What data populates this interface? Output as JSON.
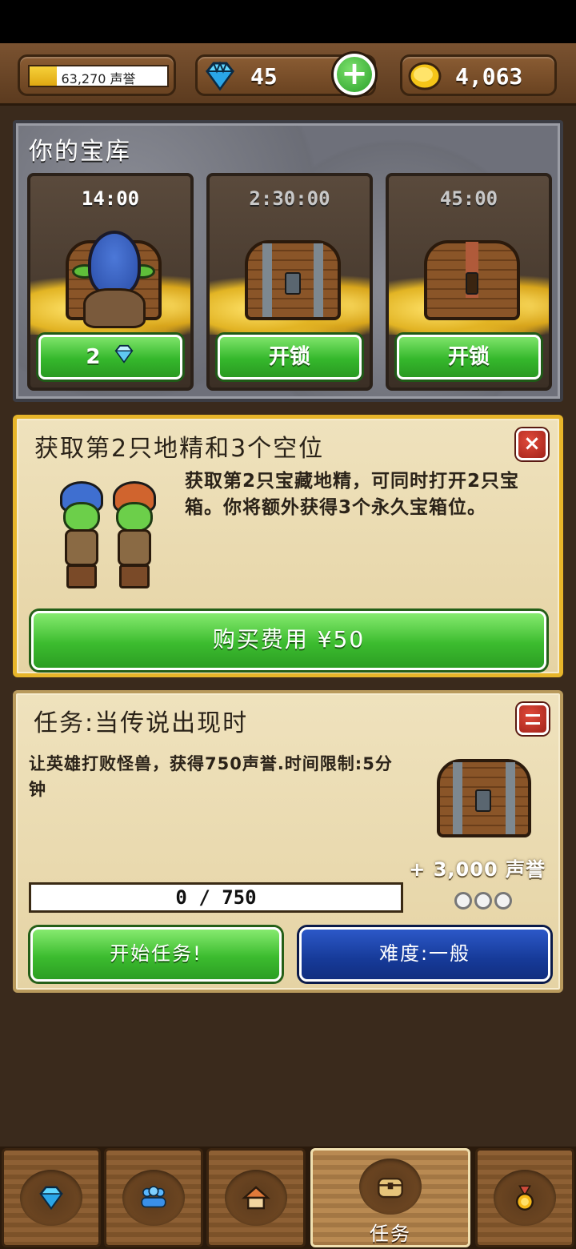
{
  "header": {
    "reputation_text": "63,270 声誉",
    "reputation_progress_percent": 20,
    "gems": "45",
    "gold": "4,063",
    "add_button_symbol": "+"
  },
  "vault": {
    "title": "你的宝库",
    "slots": [
      {
        "timer": "14:00",
        "contents": "goblin-on-chest",
        "button_label": "2",
        "button_icon": "gem-icon"
      },
      {
        "timer": "2:30:00",
        "contents": "iron-chest",
        "button_label": "开锁"
      },
      {
        "timer": "45:00",
        "contents": "wooden-chest",
        "button_label": "开锁"
      }
    ]
  },
  "offer": {
    "title": "获取第2只地精和3个空位",
    "close_symbol": "×",
    "description": "获取第2只宝藏地精，可同时打开2只宝箱。你将额外获得3个永久宝箱位。",
    "buy_label": "购买费用 ¥50"
  },
  "quest": {
    "title": "任务:当传说出现时",
    "description": "让英雄打败怪兽，获得750声誉.时间限制:5分钟",
    "reward": "+ 3,000 声誉",
    "difficulty_stars": 0,
    "progress_text": "0 / 750",
    "progress_percent": 0,
    "start_label": "开始任务!",
    "difficulty_label": "难度:一般"
  },
  "nav": {
    "tabs": [
      {
        "icon": "gem-icon",
        "label": ""
      },
      {
        "icon": "people-icon",
        "label": ""
      },
      {
        "icon": "home-icon",
        "label": ""
      },
      {
        "icon": "chest-icon",
        "label": "任务",
        "active": true
      },
      {
        "icon": "medal-icon",
        "label": ""
      }
    ]
  },
  "colors": {
    "accent_green": "#3cbc2f",
    "accent_blue": "#163a98",
    "gold_border": "#e7b52a",
    "parchment": "#efe2bd"
  }
}
